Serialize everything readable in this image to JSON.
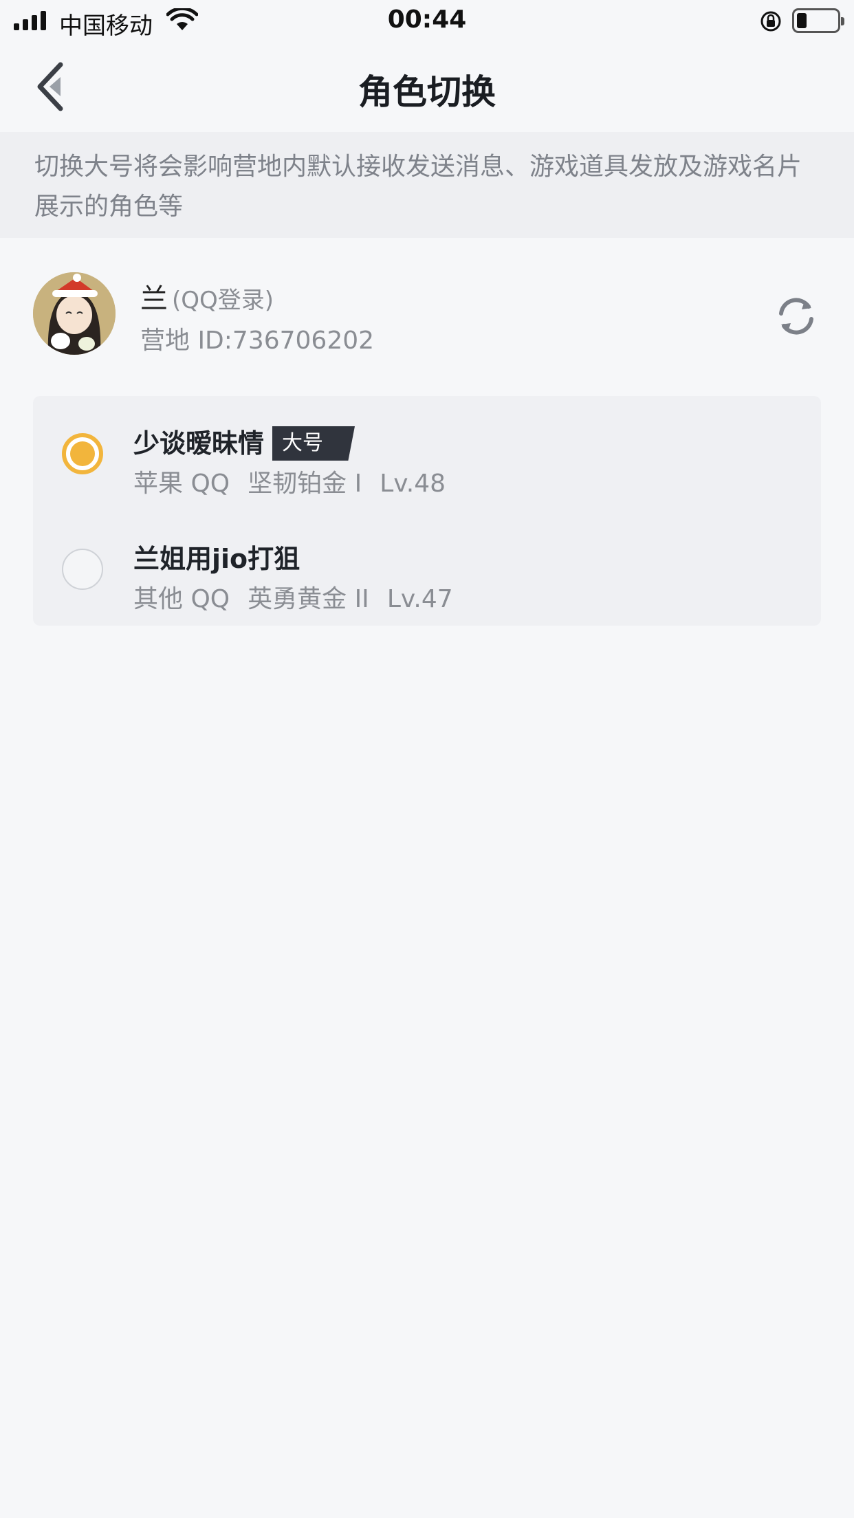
{
  "status_bar": {
    "carrier": "中国移动",
    "time": "00:44"
  },
  "nav": {
    "title": "角色切换"
  },
  "notice": {
    "text": "切换大号将会影响营地内默认接收发送消息、游戏道具发放及游戏名片展示的角色等"
  },
  "profile": {
    "name": "兰",
    "login_type": "(QQ登录)",
    "camp_id": "营地 ID:736706202"
  },
  "roles": [
    {
      "name": "少谈暧昧情",
      "badge": "大号",
      "platform": "苹果 QQ",
      "rank": "坚韧铂金 I",
      "level": "Lv.48",
      "selected": true
    },
    {
      "name": "兰姐用jio打狙",
      "badge": "",
      "platform": "其他 QQ",
      "rank": "英勇黄金 II",
      "level": "Lv.47",
      "selected": false
    }
  ],
  "colors": {
    "accent": "#f2b53c",
    "badge_bg": "#30343d",
    "background": "#f6f7f9"
  },
  "icons": {
    "back": "chevron-left-icon",
    "refresh": "refresh-icon",
    "wifi": "wifi-icon",
    "lock": "orientation-lock-icon"
  }
}
